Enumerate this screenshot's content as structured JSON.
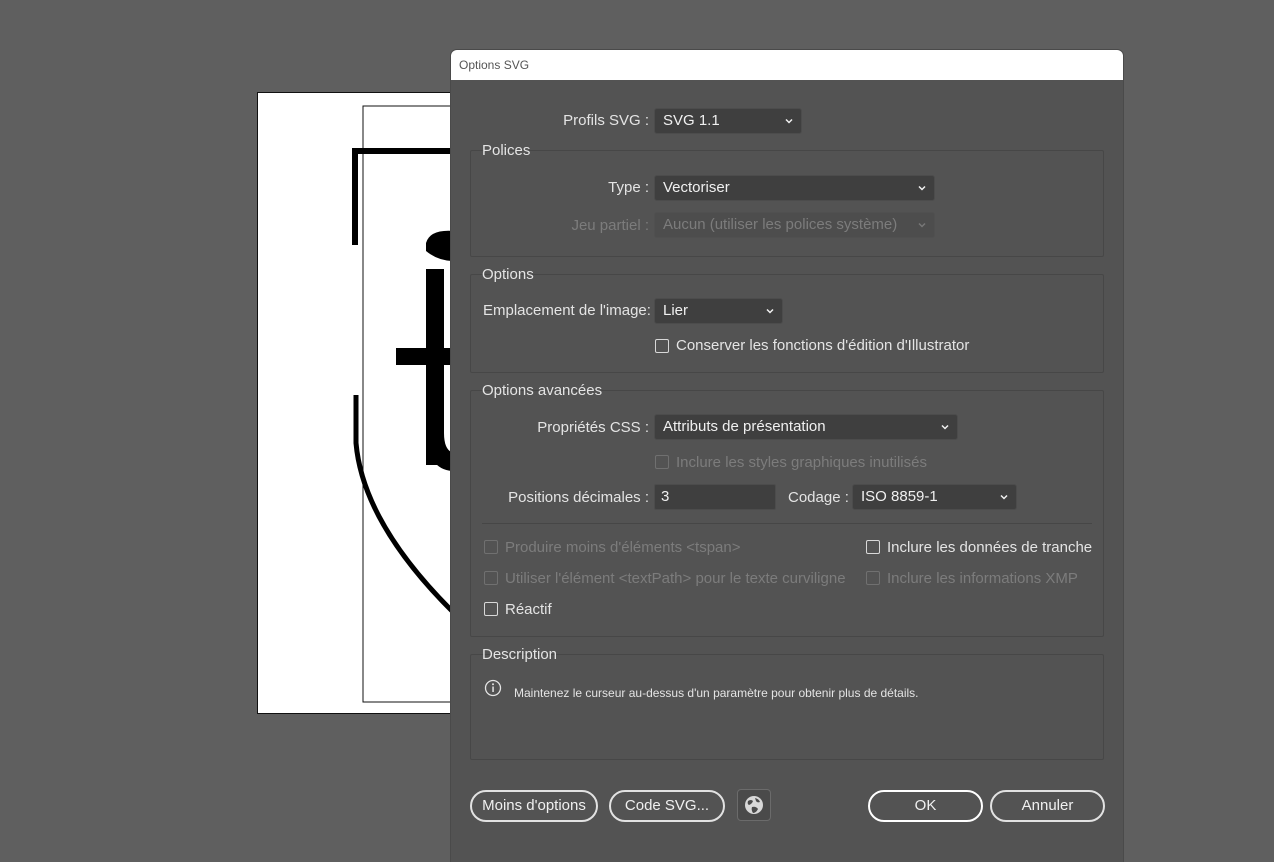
{
  "dialog": {
    "title": "Options SVG"
  },
  "profile": {
    "label": "Profils SVG :",
    "value": "SVG 1.1"
  },
  "fonts": {
    "legend": "Polices",
    "type_label": "Type :",
    "type_value": "Vectoriser",
    "subset_label": "Jeu partiel :",
    "subset_value": "Aucun (utiliser les polices système)"
  },
  "options": {
    "legend": "Options",
    "image_location_label": "Emplacement de l'image:",
    "image_location_value": "Lier",
    "preserve_illustrator_label": "Conserver les fonctions d'édition d'Illustrator"
  },
  "advanced": {
    "legend": "Options avancées",
    "css_label": "Propriétés CSS :",
    "css_value": "Attributs de présentation",
    "unused_styles_label": "Inclure les styles graphiques inutilisés",
    "decimals_label": "Positions décimales :",
    "decimals_value": "3",
    "encoding_label": "Codage :",
    "encoding_value": "ISO 8859-1",
    "fewer_tspan_label": "Produire moins d'éléments <tspan>",
    "slice_data_label": "Inclure les données de tranche",
    "textpath_label": "Utiliser l'élément <textPath> pour le texte curviligne",
    "xmp_label": "Inclure les informations XMP",
    "responsive_label": "Réactif"
  },
  "description": {
    "legend": "Description",
    "text": "Maintenez le curseur au-dessus d'un paramètre pour obtenir plus de détails."
  },
  "buttons": {
    "less_options": "Moins d'options",
    "svg_code": "Code SVG...",
    "ok": "OK",
    "cancel": "Annuler"
  },
  "icons": {
    "dropdown": "chevron-down-icon",
    "info": "info-icon",
    "web": "globe-icon"
  }
}
